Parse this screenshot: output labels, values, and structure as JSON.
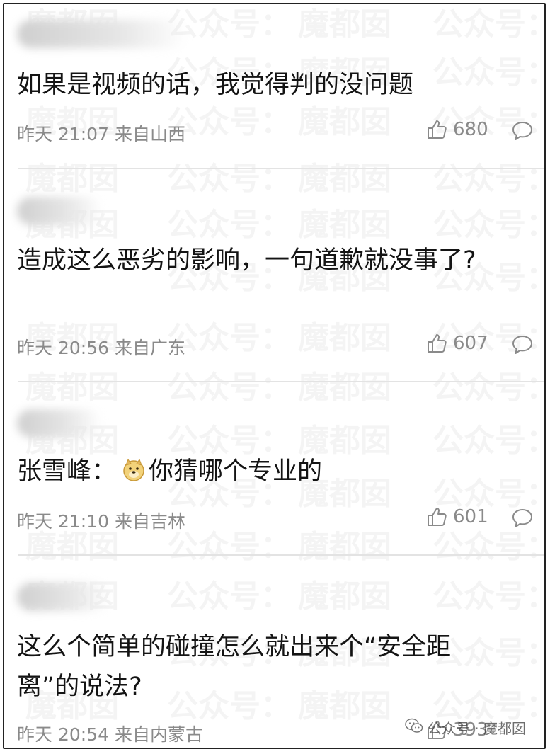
{
  "watermark_text": "魔都囡   公众号：魔都囡",
  "comments": [
    {
      "text": "如果是视频的话，我觉得判的没问题",
      "time": "昨天 21:07",
      "location": "来自山西",
      "likes": "680"
    },
    {
      "text": "造成这么恶劣的影响，一句道歉就没事了?",
      "time": "昨天 20:56",
      "location": "来自广东",
      "likes": "607"
    },
    {
      "text_prefix": "张雪峰：",
      "emoji": "doge-emoji",
      "text_suffix": "你猜哪个专业的",
      "time": "昨天 21:10",
      "location": "来自吉林",
      "likes": "601"
    },
    {
      "text": "这么个简单的碰撞怎么就出来个“安全距离”的说法?",
      "time": "昨天 20:54",
      "location": "来自内蒙古",
      "likes": "393"
    }
  ],
  "brand": {
    "label": "公众号 · 魔都囡",
    "icon": "wechat-icon"
  },
  "icons": {
    "like": "thumbs-up-icon",
    "reply": "comment-bubble-icon"
  }
}
